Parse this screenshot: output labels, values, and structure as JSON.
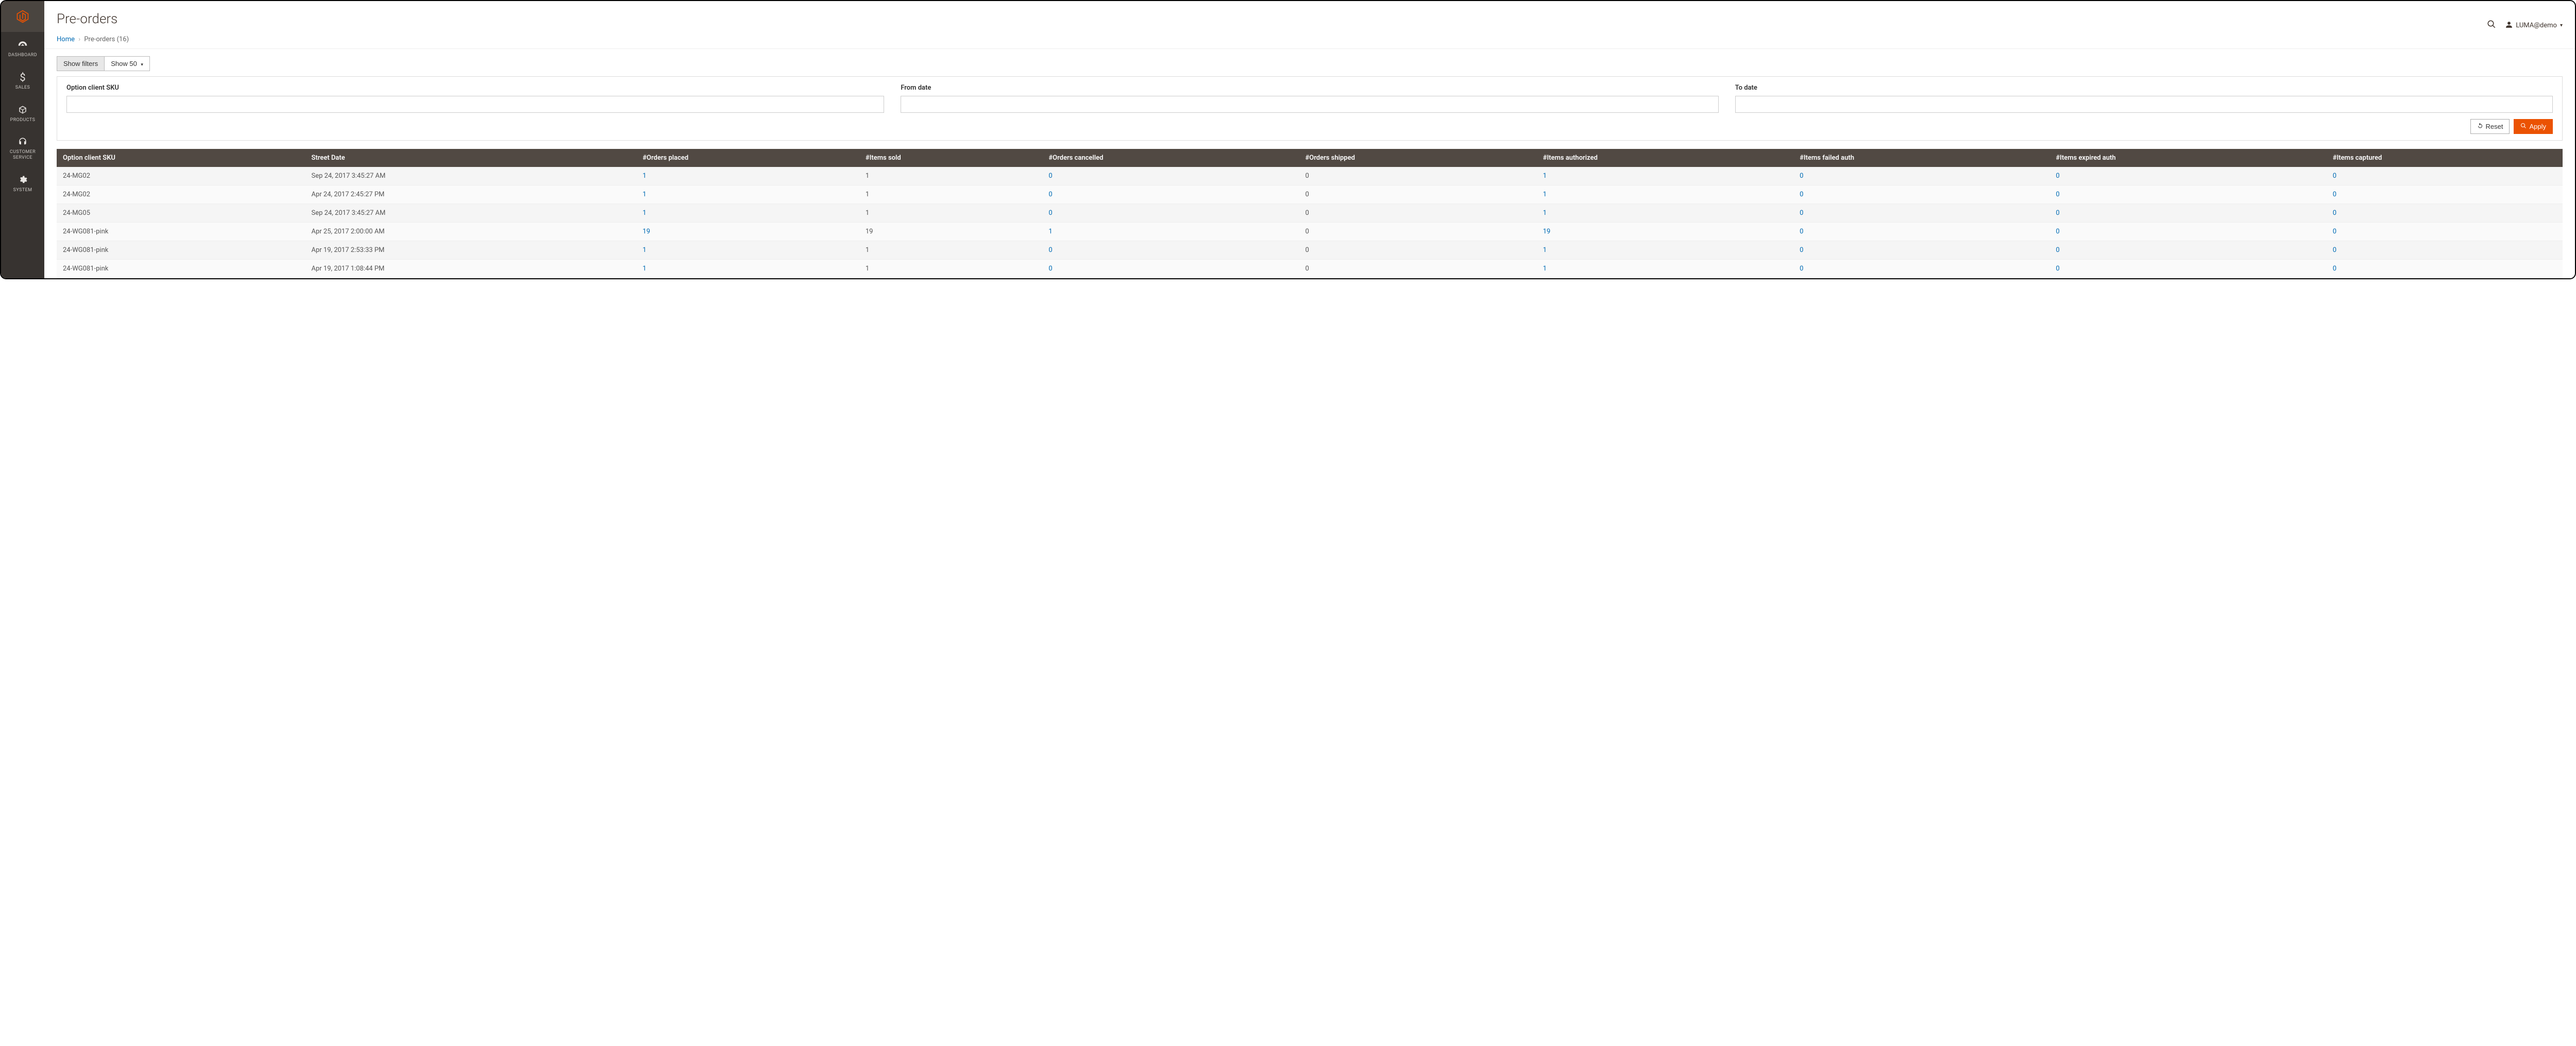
{
  "page": {
    "title": "Pre-orders"
  },
  "user": {
    "name": "LUMA@demo"
  },
  "breadcrumb": {
    "home": "Home",
    "current": "Pre-orders (16)"
  },
  "sidebar": [
    {
      "label": "DASHBOARD"
    },
    {
      "label": "SALES"
    },
    {
      "label": "PRODUCTS"
    },
    {
      "label": "CUSTOMER SERVICE"
    },
    {
      "label": "SYSTEM"
    }
  ],
  "toolbar": {
    "show_filters": "Show filters",
    "show_count": "Show 50"
  },
  "filters": {
    "sku_label": "Option client SKU",
    "from_label": "From date",
    "to_label": "To date",
    "reset": "Reset",
    "apply": "Apply"
  },
  "columns": [
    "Option client SKU",
    "Street Date",
    "#Orders placed",
    "#Items sold",
    "#Orders cancelled",
    "#Orders shipped",
    "#Items authorized",
    "#Items failed auth",
    "#Items expired auth",
    "#Items captured"
  ],
  "rows": [
    {
      "sku": "24-MG02",
      "street_date": "Sep 24, 2017 3:45:27 AM",
      "orders_placed": "1",
      "items_sold": "1",
      "orders_cancelled": "0",
      "orders_shipped": "0",
      "items_authorized": "1",
      "items_failed": "0",
      "items_expired": "0",
      "items_captured": "0"
    },
    {
      "sku": "24-MG02",
      "street_date": "Apr 24, 2017 2:45:27 PM",
      "orders_placed": "1",
      "items_sold": "1",
      "orders_cancelled": "0",
      "orders_shipped": "0",
      "items_authorized": "1",
      "items_failed": "0",
      "items_expired": "0",
      "items_captured": "0"
    },
    {
      "sku": "24-MG05",
      "street_date": "Sep 24, 2017 3:45:27 AM",
      "orders_placed": "1",
      "items_sold": "1",
      "orders_cancelled": "0",
      "orders_shipped": "0",
      "items_authorized": "1",
      "items_failed": "0",
      "items_expired": "0",
      "items_captured": "0"
    },
    {
      "sku": "24-WG081-pink",
      "street_date": "Apr 25, 2017 2:00:00 AM",
      "orders_placed": "19",
      "items_sold": "19",
      "orders_cancelled": "1",
      "orders_shipped": "0",
      "items_authorized": "19",
      "items_failed": "0",
      "items_expired": "0",
      "items_captured": "0"
    },
    {
      "sku": "24-WG081-pink",
      "street_date": "Apr 19, 2017 2:53:33 PM",
      "orders_placed": "1",
      "items_sold": "1",
      "orders_cancelled": "0",
      "orders_shipped": "0",
      "items_authorized": "1",
      "items_failed": "0",
      "items_expired": "0",
      "items_captured": "0"
    },
    {
      "sku": "24-WG081-pink",
      "street_date": "Apr 19, 2017 1:08:44 PM",
      "orders_placed": "1",
      "items_sold": "1",
      "orders_cancelled": "0",
      "orders_shipped": "0",
      "items_authorized": "1",
      "items_failed": "0",
      "items_expired": "0",
      "items_captured": "0"
    }
  ]
}
